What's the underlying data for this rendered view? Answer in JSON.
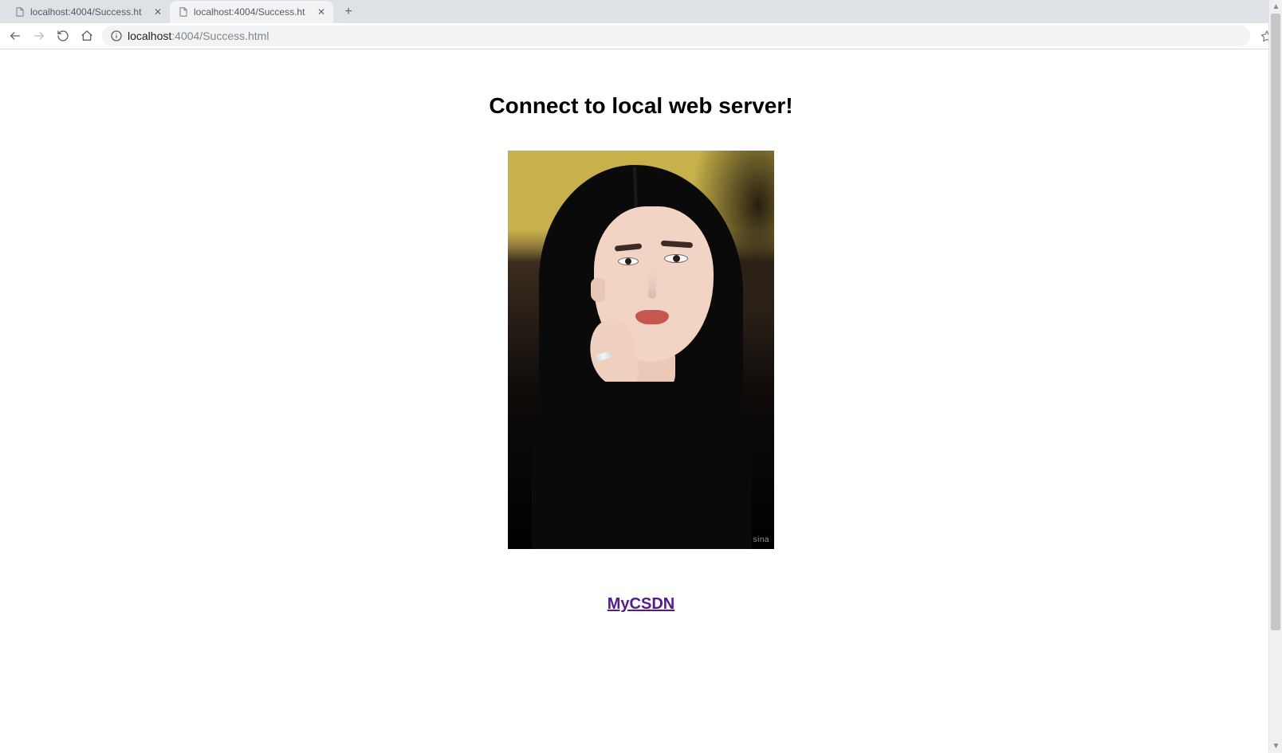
{
  "browser": {
    "tabs": [
      {
        "title": "localhost:4004/Success.ht",
        "active": false
      },
      {
        "title": "localhost:4004/Success.ht",
        "active": true
      }
    ],
    "url_host_strong": "localhost",
    "url_host_dim": ":4004/Success.html"
  },
  "page": {
    "heading": "Connect to local web server!",
    "image_watermark": "sina",
    "link_text": "MyCSDN"
  }
}
